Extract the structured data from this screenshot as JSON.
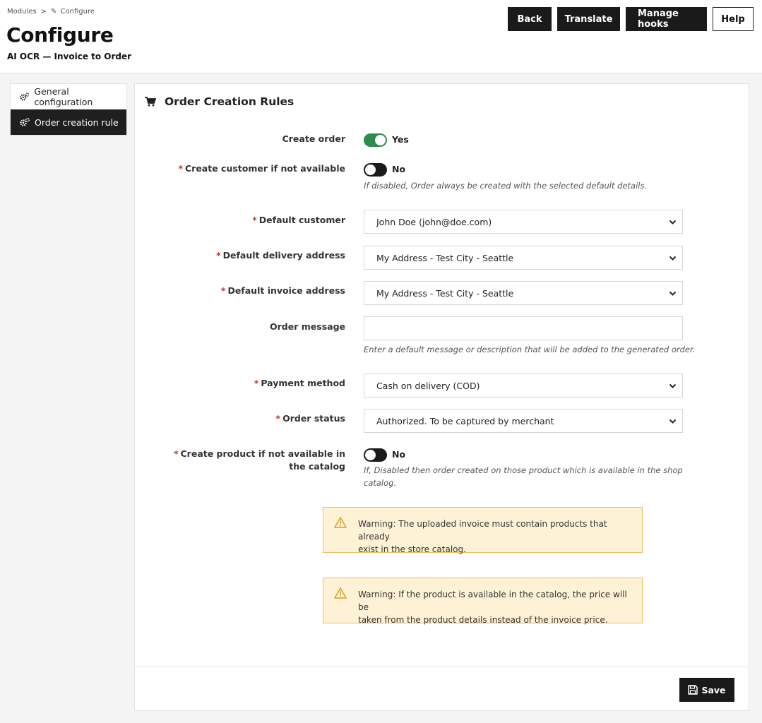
{
  "breadcrumb": {
    "modules": "Modules",
    "separator": ">",
    "current": "Configure"
  },
  "page": {
    "title": "Configure",
    "subtitle": "AI OCR — Invoice to Order"
  },
  "toolbar": {
    "back": "Back",
    "translate": "Translate",
    "manage_hooks": "Manage hooks",
    "help": "Help"
  },
  "sidebar": {
    "items": [
      {
        "label": "General configuration",
        "active": false
      },
      {
        "label": "Order creation rule",
        "active": true
      }
    ]
  },
  "panel": {
    "title": "Order Creation Rules",
    "icon": "cart-icon"
  },
  "form": {
    "create_order": {
      "label": "Create order",
      "value": "Yes",
      "on": true
    },
    "create_customer": {
      "required": "*",
      "label": "Create customer if not available",
      "value": "No",
      "on": false,
      "help": "If disabled, Order always be created with the selected default details."
    },
    "default_customer": {
      "required": "*",
      "label": "Default customer",
      "value": "John Doe (john@doe.com)"
    },
    "default_delivery": {
      "required": "*",
      "label": "Default delivery address",
      "value": "My Address - Test City - Seattle"
    },
    "default_invoice": {
      "required": "*",
      "label": "Default invoice address",
      "value": "My Address - Test City - Seattle"
    },
    "order_message": {
      "label": "Order message",
      "value": "",
      "help": "Enter a default message or description that will be added to the generated order."
    },
    "payment_method": {
      "required": "*",
      "label": "Payment method",
      "value": "Cash on delivery (COD)"
    },
    "order_status": {
      "required": "*",
      "label": "Order status",
      "value": "Authorized. To be captured by merchant"
    },
    "create_product": {
      "required": "*",
      "label_line1": "Create product if not available in",
      "label_line2": "the catalog",
      "value": "No",
      "on": false,
      "help_line1": "If, Disabled then order created on those product which is available in the shop",
      "help_line2": "catalog."
    }
  },
  "warnings": [
    {
      "line1": "Warning: The uploaded invoice must contain products that already",
      "line2": "exist in the store catalog."
    },
    {
      "line1": "Warning: If the product is available in the catalog, the price will be",
      "line2": "taken from the product details instead of the invoice price."
    }
  ],
  "footer": {
    "save": "Save"
  },
  "colors": {
    "toggle_on": "#2e8b4e",
    "dark": "#1a1a1a",
    "warning_bg": "#fdf2d5",
    "warning_border": "#f0c05a",
    "required": "#c0392b"
  }
}
